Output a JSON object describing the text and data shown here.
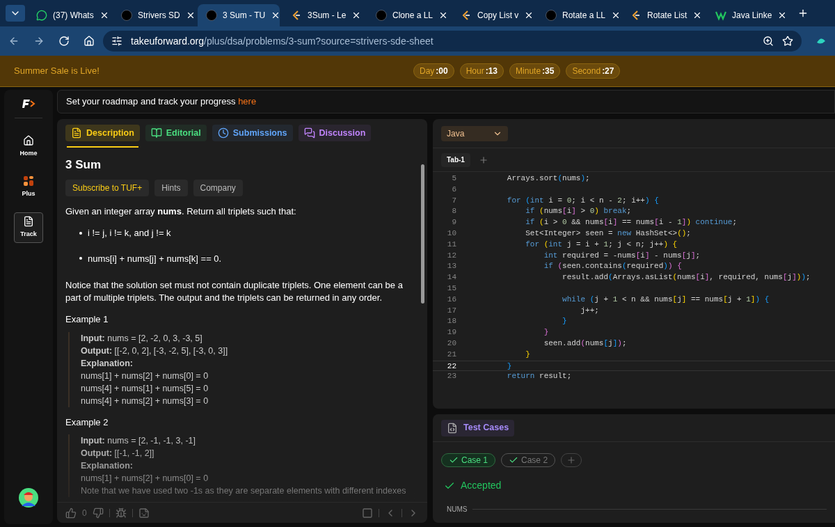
{
  "browser": {
    "tabs": [
      {
        "title": "(37) Whats",
        "kind": "chat",
        "selected": false
      },
      {
        "title": "Strivers SD",
        "kind": "tuf",
        "selected": false
      },
      {
        "title": "3 Sum - TU",
        "kind": "tuf",
        "selected": true
      },
      {
        "title": "3Sum - Le",
        "kind": "lc",
        "selected": false
      },
      {
        "title": "Clone a LL",
        "kind": "tuf",
        "selected": false
      },
      {
        "title": "Copy List v",
        "kind": "lc",
        "selected": false
      },
      {
        "title": "Rotate a LL",
        "kind": "tuf",
        "selected": false
      },
      {
        "title": "Rotate List",
        "kind": "lc",
        "selected": false
      },
      {
        "title": "Java Linke",
        "kind": "w",
        "selected": false
      }
    ],
    "url_host": "takeuforward.org",
    "url_path": "/plus/dsa/problems/3-sum?source=strivers-sde-sheet"
  },
  "banner": {
    "text": "Summer Sale is Live!",
    "timer": [
      {
        "label": "Day",
        "value": ":00"
      },
      {
        "label": "Hour",
        "value": ":13"
      },
      {
        "label": "Minute",
        "value": ":35"
      },
      {
        "label": "Second",
        "value": ":27"
      }
    ]
  },
  "sidebar": {
    "items": [
      {
        "label": "Home",
        "selected": false
      },
      {
        "label": "Plus",
        "selected": false
      },
      {
        "label": "Track",
        "selected": true
      }
    ]
  },
  "roadmap": {
    "text": "Set your roadmap and track your progress",
    "link": "here"
  },
  "problem": {
    "tabs": [
      {
        "label": "Description",
        "color": "#facc15",
        "selected": true
      },
      {
        "label": "Editorial",
        "color": "#4ade80",
        "selected": false
      },
      {
        "label": "Submissions",
        "color": "#60a5fa",
        "selected": false
      },
      {
        "label": "Discussion",
        "color": "#c084fc",
        "selected": false
      }
    ],
    "title": "3 Sum",
    "chips": [
      {
        "label": "Subscribe to TUF+",
        "kind": "primary"
      },
      {
        "label": "Hints",
        "kind": "plain"
      },
      {
        "label": "Company",
        "kind": "plain"
      }
    ],
    "intro": "Given an integer array **nums**. Return all triplets such that:",
    "bullets": [
      "i != j, i != k, and j != k",
      "nums[i] + nums[j] + nums[k] == 0."
    ],
    "notice": "Notice that the solution set must not contain duplicate triplets. One element can be a part of multiple triplets. The output and the triplets can be returned in any order.",
    "examples": [
      {
        "title": "Example 1",
        "lines": [
          "**Input:** nums = [2, -2, 0, 3, -3, 5]",
          "**Output:** [[-2, 0, 2], [-3, -2, 5], [-3, 0, 3]]",
          "**Explanation:**",
          "nums[1] + nums[2] + nums[0] = 0",
          "nums[4] + nums[1] + nums[5] = 0",
          "nums[4] + nums[2] + nums[3] = 0"
        ]
      },
      {
        "title": "Example 2",
        "lines": [
          "**Input:** nums = [2, -1, -1, 3, -1]",
          "**Output:** [[-1, -1, 2]]",
          "**Explanation:**",
          "nums[1] + nums[2] + nums[0] = 0",
          "Note that we have used two -1s as they are separate elements with different indexes"
        ]
      }
    ],
    "likes": "0"
  },
  "editor": {
    "language": "Java",
    "tab": "Tab-1",
    "lines": [
      {
        "n": "5",
        "current": false,
        "text": "        Arrays.sort(nums);"
      },
      {
        "n": "6",
        "current": false
      },
      {
        "n": "7",
        "current": false,
        "text": "        for (int i = 0; i < n - 2; i++) {"
      },
      {
        "n": "8",
        "current": false,
        "text": "            if (nums[i] > 0) break;"
      },
      {
        "n": "9",
        "current": false,
        "text": "            if (i > 0 && nums[i] == nums[i - 1]) continue;"
      },
      {
        "n": "10",
        "current": false,
        "text": "            Set<Integer> seen = new HashSet<>();"
      },
      {
        "n": "11",
        "current": false,
        "text": "            for (int j = i + 1; j < n; j++) {"
      },
      {
        "n": "12",
        "current": false,
        "text": "                int required = -nums[i] - nums[j];"
      },
      {
        "n": "13",
        "current": false,
        "text": "                if (seen.contains(required)) {"
      },
      {
        "n": "14",
        "current": false,
        "text": "                    result.add(Arrays.asList(nums[i], required, nums[j]));"
      },
      {
        "n": "15",
        "current": false
      },
      {
        "n": "16",
        "current": false,
        "text": "                    while (j + 1 < n && nums[j] == nums[j + 1]) {"
      },
      {
        "n": "17",
        "current": false,
        "text": "                        j++;"
      },
      {
        "n": "18",
        "current": false,
        "text": "                    }"
      },
      {
        "n": "19",
        "current": false,
        "text": "                }"
      },
      {
        "n": "20",
        "current": false,
        "text": "                seen.add(nums[j]);"
      },
      {
        "n": "21",
        "current": false,
        "text": "            }"
      },
      {
        "n": "22",
        "current": true,
        "text": "        }"
      },
      {
        "n": "23",
        "current": false,
        "text": "        return result;"
      }
    ]
  },
  "tests": {
    "title": "Test Cases",
    "cases": [
      {
        "label": "Case 1",
        "passed": true,
        "selected": true
      },
      {
        "label": "Case 2",
        "passed": true,
        "selected": false
      }
    ],
    "status": "Accepted",
    "field_label": "NUMS"
  }
}
